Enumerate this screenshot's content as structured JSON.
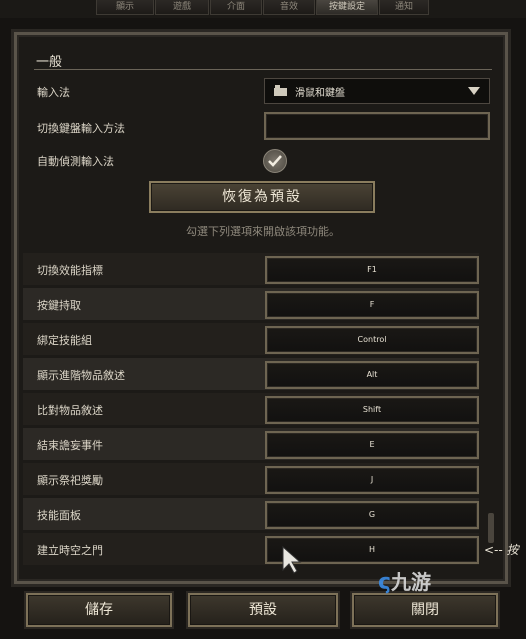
{
  "tabs": [
    {
      "label": "顯示",
      "active": false
    },
    {
      "label": "遊戲",
      "active": false
    },
    {
      "label": "介面",
      "active": false
    },
    {
      "label": "音效",
      "active": false
    },
    {
      "label": "按鍵設定",
      "active": true
    },
    {
      "label": "通知",
      "active": false
    }
  ],
  "section": {
    "title": "一般"
  },
  "input_method": {
    "label": "輸入法",
    "value": "滑鼠和鍵盤",
    "icon": "mouse-keyboard-icon"
  },
  "switch_input": {
    "label": "切換鍵盤輸入方法",
    "value": ""
  },
  "auto_detect": {
    "label": "自動偵測輸入法",
    "checked": true
  },
  "reset_button": "恢復為預設",
  "hint": "勾選下列選項來開啟該項功能。",
  "bindings": [
    {
      "label": "切換效能指標",
      "key": "F1"
    },
    {
      "label": "按鍵持取",
      "key": "F"
    },
    {
      "label": "綁定技能組",
      "key": "Control"
    },
    {
      "label": "顯示進階物品敘述",
      "key": "Alt"
    },
    {
      "label": "比對物品敘述",
      "key": "Shift"
    },
    {
      "label": "結束譫妄事件",
      "key": "E"
    },
    {
      "label": "顯示祭祀獎勵",
      "key": "J"
    },
    {
      "label": "技能面板",
      "key": "G"
    },
    {
      "label": "建立時空之門",
      "key": "H"
    }
  ],
  "side_note": "<-- 按",
  "bottom": {
    "save": "儲存",
    "default": "預設",
    "close": "關閉"
  },
  "watermark": "九游",
  "colors": {
    "accent": "#8a7d5e",
    "background": "#151311",
    "text": "#dcd6c8"
  }
}
